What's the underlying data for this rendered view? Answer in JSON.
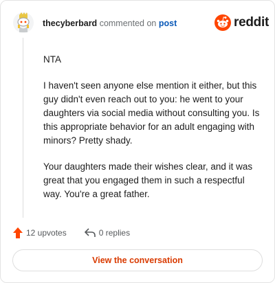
{
  "header": {
    "username": "thecyberbard",
    "action_text": "commented on",
    "post_link": "post"
  },
  "brand": {
    "wordmark": "reddit",
    "color": "#ff4500"
  },
  "comment": {
    "paragraphs": [
      "NTA",
      "I haven't seen anyone else mention it either, but this guy didn't even reach out to you: he went to your daughters via social media without consulting you. Is this appropriate behavior for an adult engaging with minors? Pretty shady.",
      "Your daughters made their wishes clear, and it was great that you engaged them in such a respectful way. You're a great father."
    ]
  },
  "actions": {
    "upvotes": "12 upvotes",
    "replies": "0 replies"
  },
  "cta": {
    "label": "View the conversation",
    "color": "#d93a00"
  },
  "icons": {
    "upvote": "upvote-arrow-icon",
    "reply": "reply-arrow-icon",
    "logo": "reddit-snoo-icon"
  }
}
